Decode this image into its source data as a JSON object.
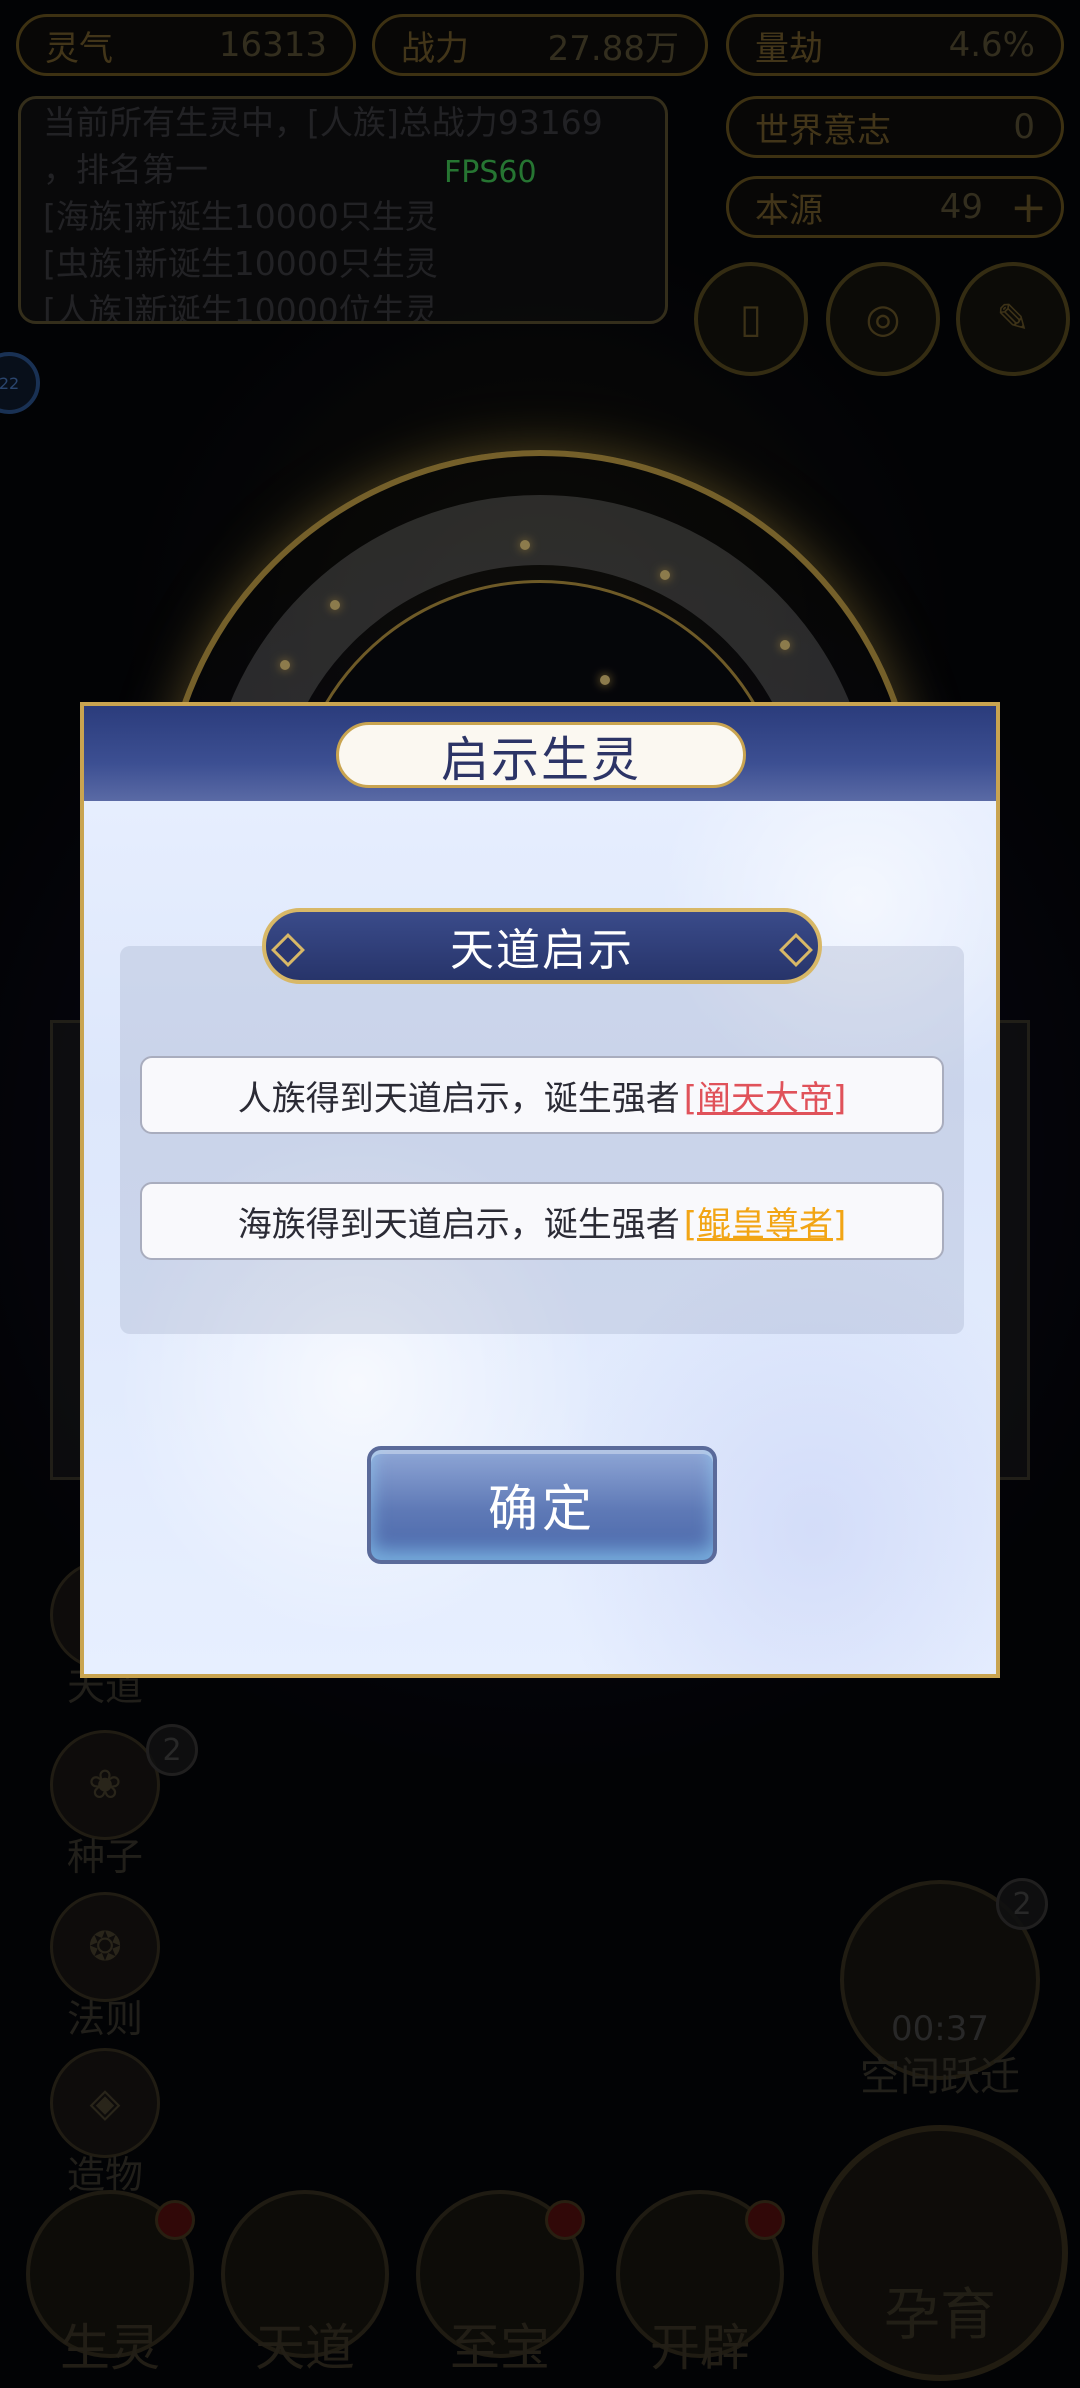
{
  "hud": {
    "lingqi": {
      "label": "灵气",
      "value": "16313"
    },
    "zhanli": {
      "label": "战力",
      "value": "27.88万"
    },
    "liangjie": {
      "label": "量劫",
      "value": "4.6%"
    },
    "world_will": {
      "label": "世界意志",
      "value": "0"
    },
    "benyuan": {
      "label": "本源",
      "value": "49"
    },
    "side_badge": "22",
    "fps": "FPS60"
  },
  "log": [
    "当前所有生灵中，[人族]总战力93169",
    "，排名第一",
    "[海族]新诞生10000只生灵",
    "[虫族]新诞生10000只生灵",
    "[人族]新诞生10000位生灵"
  ],
  "left_menu": [
    {
      "label": "天道"
    },
    {
      "label": "种子",
      "badge": "2"
    },
    {
      "label": "法则"
    },
    {
      "label": "造物"
    }
  ],
  "space_jump": {
    "timer": "00:37",
    "label": "空间跃迁",
    "badge": "2"
  },
  "bottom_nav": [
    {
      "label": "生灵"
    },
    {
      "label": "天道"
    },
    {
      "label": "至宝"
    },
    {
      "label": "开辟"
    }
  ],
  "main_button": {
    "label": "孕育"
  },
  "dialog": {
    "title": "启示生灵",
    "banner": "天道启示",
    "messages": [
      {
        "text": "人族得到天道启示，诞生强者",
        "name": "[阐天大帝]",
        "color": "#e0525a"
      },
      {
        "text": "海族得到天道启示，诞生强者",
        "name": "[鲲皇尊者]",
        "color": "#f2a515"
      }
    ],
    "confirm": "确定"
  }
}
